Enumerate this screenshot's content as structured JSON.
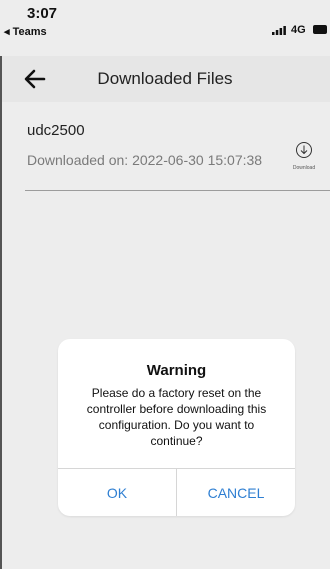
{
  "status_bar": {
    "time": "3:07",
    "back_app": "◂ Teams",
    "network": "4G",
    "icons": [
      "signal-icon",
      "battery-icon"
    ]
  },
  "header": {
    "title": "Downloaded Files",
    "back_icon": "back-arrow-icon"
  },
  "file": {
    "name": "udc2500",
    "downloaded_on": "Downloaded on: 2022-06-30 15:07:38",
    "download_label": "Download",
    "download_icon": "download-icon"
  },
  "dialog": {
    "title": "Warning",
    "message": "Please do a factory reset on the controller before downloading this configuration. Do you want to continue?",
    "ok_label": "OK",
    "cancel_label": "CANCEL",
    "button_color": "#2f7fd2"
  }
}
